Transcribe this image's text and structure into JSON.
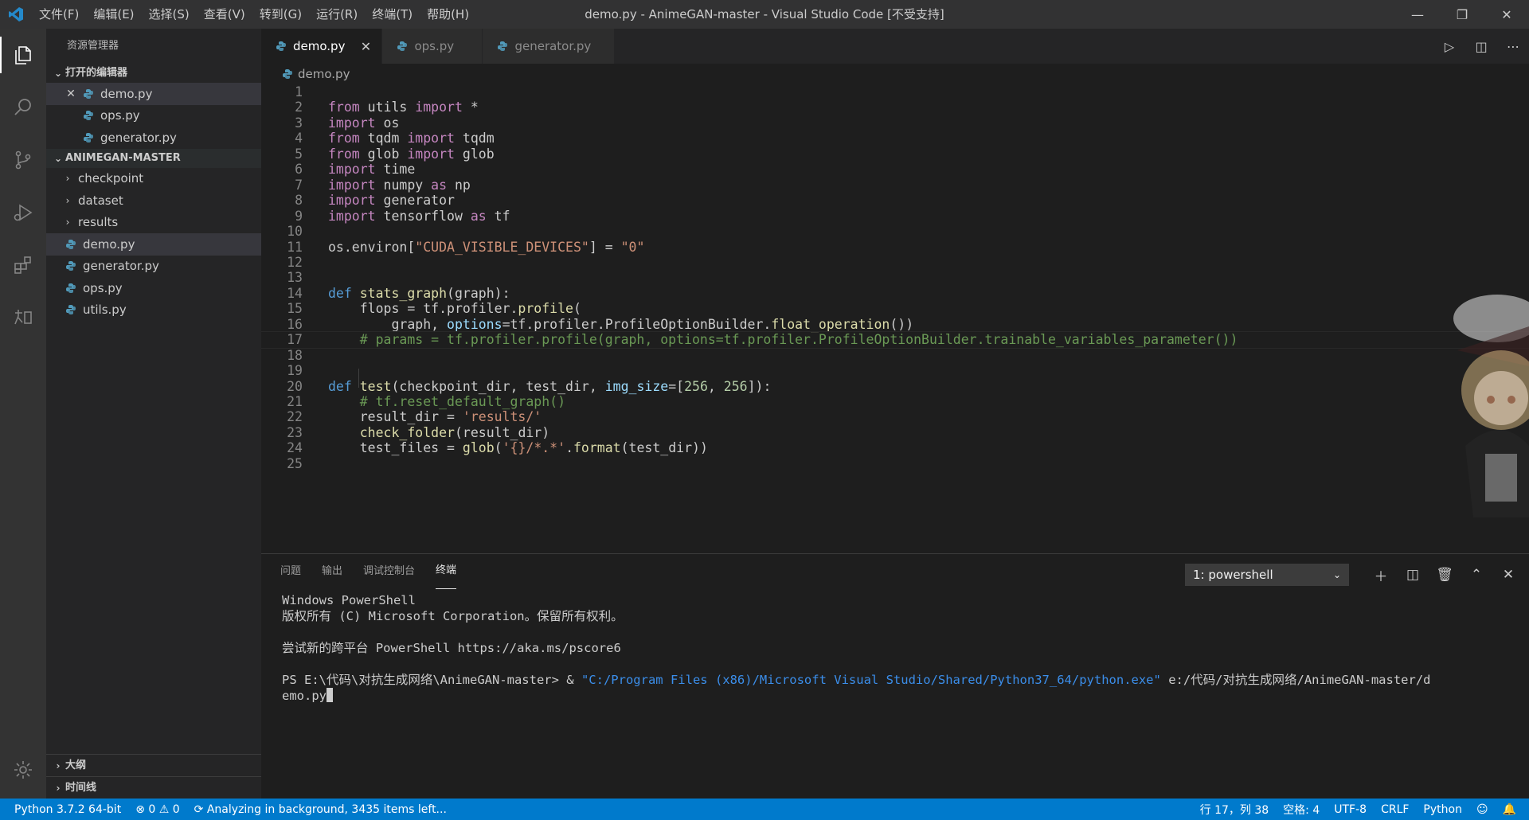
{
  "window": {
    "title": "demo.py - AnimeGAN-master - Visual Studio Code [不受支持]",
    "menu": [
      "文件(F)",
      "编辑(E)",
      "选择(S)",
      "查看(V)",
      "转到(G)",
      "运行(R)",
      "终端(T)",
      "帮助(H)"
    ]
  },
  "sidebar": {
    "title": "资源管理器",
    "open_editors_label": "打开的编辑器",
    "open_editors": [
      "demo.py",
      "ops.py",
      "generator.py"
    ],
    "project_label": "ANIMEGAN-MASTER",
    "folders": [
      "checkpoint",
      "dataset",
      "results"
    ],
    "files": [
      "demo.py",
      "generator.py",
      "ops.py",
      "utils.py"
    ],
    "outline_label": "大纲",
    "timeline_label": "时间线"
  },
  "tabs": [
    {
      "label": "demo.py"
    },
    {
      "label": "ops.py"
    },
    {
      "label": "generator.py"
    }
  ],
  "breadcrumb": "demo.py",
  "code_lines": [
    "",
    "from utils import *",
    "import os",
    "from tqdm import tqdm",
    "from glob import glob",
    "import time",
    "import numpy as np",
    "import generator",
    "import tensorflow as tf",
    "",
    "os.environ[\"CUDA_VISIBLE_DEVICES\"] = \"0\"",
    "",
    "",
    "def stats_graph(graph):",
    "    flops = tf.profiler.profile(",
    "        graph, options=tf.profiler.ProfileOptionBuilder.float_operation())",
    "    # params = tf.profiler.profile(graph, options=tf.profiler.ProfileOptionBuilder.trainable_variables_parameter())",
    "",
    "",
    "def test(checkpoint_dir, test_dir, img_size=[256, 256]):",
    "    # tf.reset_default_graph()",
    "    result_dir = 'results/'",
    "    check_folder(result_dir)",
    "    test_files = glob('{}/*.*'.format(test_dir))",
    ""
  ],
  "panel": {
    "tabs": [
      "问题",
      "输出",
      "调试控制台",
      "终端"
    ],
    "terminal_selector": "1: powershell",
    "terminal_lines": {
      "l1": "Windows PowerShell",
      "l2": "版权所有 (C) Microsoft Corporation。保留所有权利。",
      "l3": "尝试新的跨平台 PowerShell https://aka.ms/pscore6",
      "prompt": "PS E:\\代码\\对抗生成网络\\AnimeGAN-master> & ",
      "exe": "\"C:/Program Files (x86)/Microsoft Visual Studio/Shared/Python37_64/python.exe\"",
      "arg": " e:/代码/对抗生成网络/AnimeGAN-master/d",
      "arg2": "emo.py"
    }
  },
  "statusbar": {
    "python": "Python 3.7.2 64-bit",
    "errors": "0",
    "warnings": "0",
    "analysis": "Analyzing in background, 3435 items left...",
    "position": "行 17，列 38",
    "spaces": "空格: 4",
    "encoding": "UTF-8",
    "eol": "CRLF",
    "language": "Python"
  },
  "colors": {
    "accent": "#007acc",
    "keyword": "#c586c0",
    "def": "#569cd6",
    "function": "#dcdcaa",
    "string": "#ce9178",
    "comment": "#6a9955"
  }
}
